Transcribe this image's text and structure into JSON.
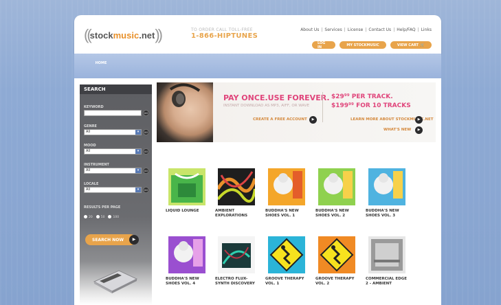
{
  "header": {
    "logo_paren_left": "((",
    "logo_stock": "stock",
    "logo_music": "music",
    "logo_net": ".net",
    "logo_paren_right": "))",
    "tollfree_small": "TO ORDER CALL TOLL-FREE",
    "tollfree_number": "1-866-HIPTUNES",
    "links": [
      "About Us",
      "Services",
      "License",
      "Contact Us",
      "Help/FAQ",
      "Links"
    ],
    "buttons": [
      "LOG IN",
      "MY STOCKMUSIC",
      "VIEW CART"
    ]
  },
  "nav": {
    "items": [
      "HOME"
    ]
  },
  "sidebar": {
    "title": "SEARCH",
    "keyword_label": "KEYWORD",
    "genre_label": "GENRE",
    "genre_value": "All",
    "mood_label": "MOOD",
    "mood_value": "All",
    "instrument_label": "INSTRUMENT",
    "instrument_value": "All",
    "locale_label": "LOCALE",
    "locale_value": "All",
    "go_label": "GO",
    "results_label": "RESULTS PER PAGE",
    "radio_options": [
      "20",
      "50",
      "100"
    ],
    "search_button": "SEARCH NOW"
  },
  "banner": {
    "title": "PAY ONCE.USE FOREVER.",
    "subtitle": "INSTANT DOWNLOAD AS MP3, AIFF, OR WAVE",
    "create_account": "CREATE A FREE ACCOUNT",
    "price1": "$29⁹⁹ PER TRACK.",
    "price2": "$199⁹⁹ FOR 10 TRACKS",
    "learn_more": "LEARN MORE ABOUT STOCKMUSIC.NET",
    "whats_new": "WHAT'S NEW"
  },
  "albums": [
    {
      "title": "LIQUID LOUNGE"
    },
    {
      "title": "AMBIENT EXPLORATIONS"
    },
    {
      "title": "BUDDHA'S NEW SHOES VOL. 1"
    },
    {
      "title": "BUDDHA'S NEW SHOES VOL. 2"
    },
    {
      "title": "BUDDHA'S NEW SHOES VOL. 3"
    },
    {
      "title": "BUDDHA'S NEW SHOES VOL. 4"
    },
    {
      "title": "ELECTRO FLUX-SYNTH DISCOVERY"
    },
    {
      "title": "GROOVE THERAPY VOL. 1"
    },
    {
      "title": "GROOVE THERAPY VOL. 2"
    },
    {
      "title": "COMMERCIAL EDGE 2 - AMBIENT"
    }
  ],
  "colors": {
    "accent_orange": "#e8a44b",
    "accent_pink": "#e0457b",
    "background_blue": "#8eaad4"
  }
}
